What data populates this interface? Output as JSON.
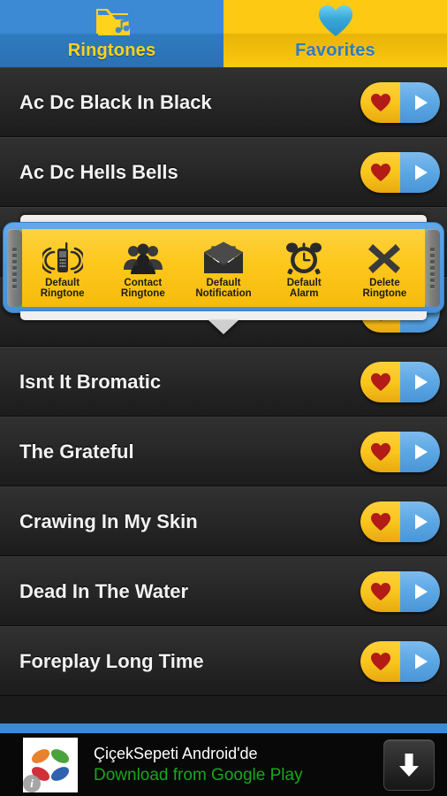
{
  "tabs": [
    {
      "label": "Ringtones",
      "icon": "folder-music-icon",
      "selected": false
    },
    {
      "label": "Favorites",
      "icon": "heart-icon",
      "selected": true
    }
  ],
  "list": {
    "rows": [
      {
        "title": "Ac Dc Black In Black"
      },
      {
        "title": "Ac Dc Hells Bells"
      },
      {
        "title": ""
      },
      {
        "title": ""
      },
      {
        "title": "Isnt It Bromatic"
      },
      {
        "title": "The Grateful"
      },
      {
        "title": "Crawing In My Skin"
      },
      {
        "title": "Dead In The Water"
      },
      {
        "title": "Foreplay Long Time"
      }
    ],
    "favorite_icon": "heart-icon",
    "play_icon": "play-icon"
  },
  "popup": {
    "items": [
      {
        "line1": "Default",
        "line2": "Ringtone",
        "icon": "ringing-phone-icon"
      },
      {
        "line1": "Contact",
        "line2": "Ringtone",
        "icon": "contacts-icon"
      },
      {
        "line1": "Default",
        "line2": "Notification",
        "icon": "envelope-icon"
      },
      {
        "line1": "Default",
        "line2": "Alarm",
        "icon": "alarm-clock-icon"
      },
      {
        "line1": "Delete",
        "line2": "Ringtone",
        "icon": "close-x-icon"
      }
    ]
  },
  "ad": {
    "title": "ÇiçekSepeti Android'de",
    "subtitle": "Download from Google Play",
    "info_badge": "i",
    "download_icon": "download-arrow-icon",
    "logo_icon": "pinwheel-flower-logo"
  },
  "colors": {
    "accent_blue": "#3d8ad4",
    "accent_yellow": "#fdc913",
    "heart_red": "#b31b17",
    "ad_green": "#17a81b",
    "list_bg": "#252525"
  }
}
